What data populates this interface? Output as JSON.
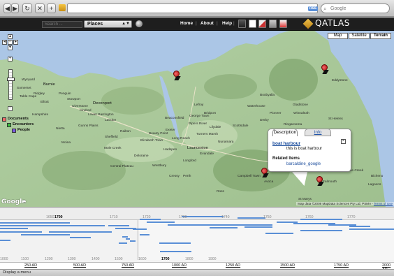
{
  "browser": {
    "nav_buttons": [
      "◀",
      "▶",
      "↻",
      "✕",
      "+"
    ],
    "rss": "RSS",
    "search_placeholder": "Google"
  },
  "app": {
    "search_placeholder": "Search ...",
    "dropdown_value": "Places",
    "nav": [
      "Home",
      "About",
      "Help"
    ],
    "logo": "QATLAS"
  },
  "map": {
    "types": [
      "Map",
      "Satellite",
      "Terrain"
    ],
    "active_type": "Terrain",
    "legend": [
      {
        "label": "Documents",
        "color": "#ee6a6a"
      },
      {
        "label": "Encounters",
        "color": "#3fbf3f"
      },
      {
        "label": "People",
        "color": "#7a5ae0"
      }
    ],
    "labels": [
      "Wynyard",
      "Burnie",
      "Devonport",
      "Ulverstone",
      "Penguin",
      "Latrobe",
      "Sheffield",
      "Railton",
      "Deloraine",
      "Westbury",
      "Longford",
      "Evandale",
      "Launceston",
      "Beaconsfield",
      "Exeter",
      "George Town",
      "Beauty Point",
      "Long Reach",
      "Bridport",
      "Scottsdale",
      "Derby",
      "Bicheno",
      "Gladstone",
      "Boobyalla",
      "St Marys",
      "Fingal",
      "Campbell Town",
      "Cressy",
      "Perth",
      "Hadspen",
      "Mole Creek",
      "Elizabeth Town",
      "Ross",
      "Moina",
      "Gunns Plains",
      "Lilydale",
      "Nunamara",
      "Avoca",
      "Mathinna",
      "Eddystone",
      "Four Mile Creek",
      "Falmouth",
      "Scamander",
      "St Helens",
      "Ringarooma",
      "Winnaleah",
      "Pioneer",
      "Weldborough",
      "Waterhouse",
      "Lefroy",
      "Pipers River",
      "Turners Marsh",
      "Lower Barrington",
      "Nietta",
      "Kindred",
      "Hampshire",
      "Elliott",
      "Somerset",
      "Table Cape",
      "Ridgley",
      "Stowport",
      "Central Plateau",
      "Lagoons"
    ],
    "info": {
      "tabs": [
        "Description",
        "Info"
      ],
      "title": "boat harbour",
      "description": "this is boat harbour",
      "related_heading": "Related Items",
      "related_link": "barcaldine_google"
    },
    "credit_text": "Map data ©2008 MapData Sciences Pty Ltd, PSMA -",
    "credit_link": "Terms of Use",
    "google": "Google"
  },
  "timeline": {
    "upper_labels": [
      "1650",
      "1700",
      "1710",
      "1720",
      "1730",
      "1740",
      "1750",
      "1760",
      "1770"
    ],
    "upper_bold": "1700",
    "lower_labels": [
      "1000",
      "1100",
      "1200",
      "1300",
      "1400",
      "1500",
      "1600",
      "1700",
      "1800",
      "1900"
    ],
    "lower_bold": "1700",
    "overview": [
      "250 AD",
      "500 AD",
      "750 AD",
      "1000 AD",
      "1250 AD",
      "1500 AD",
      "1750 AD",
      "2000 AD"
    ]
  },
  "status": "Display a menu",
  "colors": {
    "water": "#abc6e6",
    "land": "#a7c79a",
    "pin": "#c51b1b",
    "timeline_bar": "#5a8fd6"
  }
}
